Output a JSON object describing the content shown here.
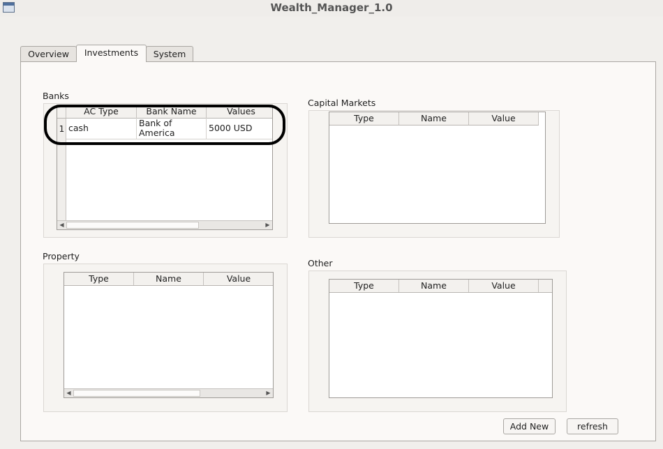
{
  "window": {
    "title": "Wealth_Manager_1.0"
  },
  "tabs": [
    {
      "label": "Overview"
    },
    {
      "label": "Investments"
    },
    {
      "label": "System"
    }
  ],
  "banks": {
    "label": "Banks",
    "columns": [
      "AC Type",
      "Bank Name",
      "Values"
    ],
    "rows": [
      {
        "num": "1",
        "ac_type": "cash",
        "bank_name_line1": "Bank of",
        "bank_name_line2": "America",
        "value": "5000 USD"
      }
    ]
  },
  "capital_markets": {
    "label": "Capital Markets",
    "columns": [
      "Type",
      "Name",
      "Value"
    ]
  },
  "property": {
    "label": "Property",
    "columns": [
      "Type",
      "Name",
      "Value"
    ]
  },
  "other": {
    "label": "Other",
    "columns": [
      "Type",
      "Name",
      "Value"
    ]
  },
  "buttons": {
    "add_new": "Add New",
    "refresh": "refresh"
  }
}
